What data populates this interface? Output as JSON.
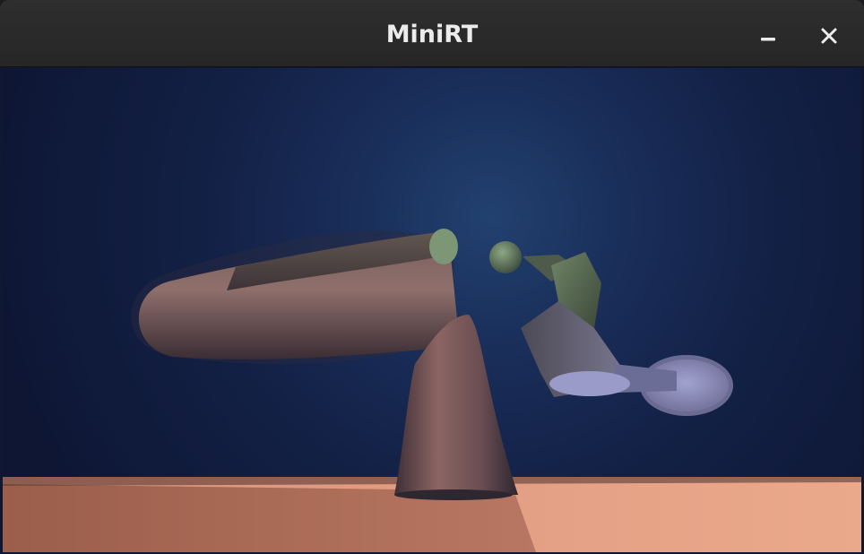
{
  "window": {
    "title": "MiniRT"
  },
  "titlebar": {
    "minimize_icon": "minimize-icon",
    "close_icon": "close-icon"
  },
  "colors": {
    "titlebar": "#2b2b2b",
    "title_text": "#ececec",
    "sky_center": "#1f3a6a",
    "sky_edge": "#0f1835",
    "floor_light": "#e3a184",
    "floor_dark": "#a86750",
    "pink_object": "#a06f6c",
    "green_object": "#7b9a72",
    "lavender_object": "#a4a6d2"
  }
}
